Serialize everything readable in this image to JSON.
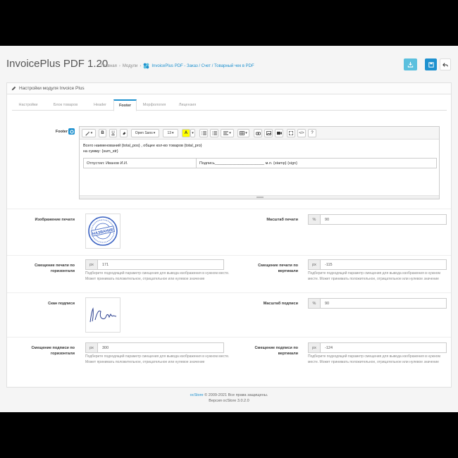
{
  "header": {
    "title": "InvoicePlus PDF 1.20",
    "breadcrumb": [
      "Главная",
      "Модули",
      "InvoicePlus PDF - Заказ / Счет / Товарный чек в PDF"
    ],
    "buttons": {
      "download": "download-icon",
      "save": "save-icon",
      "back": "reply-icon"
    },
    "colors": {
      "download": "#5bc0de",
      "save": "#1e91cf"
    }
  },
  "panel": {
    "title": "Настройки модуля Invoice Plus",
    "tabs": [
      "Настройки",
      "Блок товаров",
      "Header",
      "Footer",
      "Морфология",
      "Лицензия"
    ],
    "active_tab": "Footer"
  },
  "editor": {
    "label": "Footer",
    "font": "Open Sans",
    "size": "13",
    "line1": "Всего наименований {total_pos} , общее кол-во товаров {total_pro}",
    "line2": "на сумму: {sum_str}",
    "cell1": "Отпустил: Иванов И.И.",
    "cell2": "Подпись_______________________ м.п. {stamp} {sign}"
  },
  "fields": {
    "stamp_image_label": "Изображение печати",
    "stamp_text": "НАЗВАНИЕ",
    "stamp_scale": {
      "label": "Масштаб печати",
      "addon": "%",
      "value": "90"
    },
    "stamp_offset_h": {
      "label": "Смещение печати по горизонтали",
      "addon": "px",
      "value": "171"
    },
    "stamp_offset_v": {
      "label": "Смещение печати по вертикали",
      "addon": "px",
      "value": "-115"
    },
    "sign_image_label": "Скан подписи",
    "sign_scale": {
      "label": "Масштаб подписи",
      "addon": "%",
      "value": "90"
    },
    "sign_offset_h": {
      "label": "Смещение подписи по горизонтали",
      "addon": "px",
      "value": "300"
    },
    "sign_offset_v": {
      "label": "Смещение подписи по вертикали",
      "addon": "px",
      "value": "-124"
    },
    "help": "Подберите подходящий параметр смещения для вывода изображения в нужном месте. Может принимать положительное, отрицательное или нулевое значение"
  },
  "footer": {
    "brand": "ocStore",
    "copyright": "© 2009-2021 Все права защищены.",
    "version": "Версия ocStore 3.0.2.0"
  }
}
